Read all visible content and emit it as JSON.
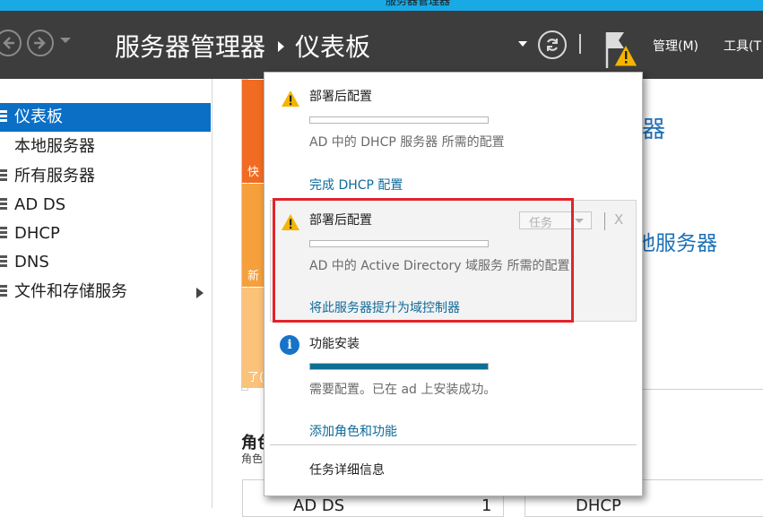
{
  "window_title_fragment": "服务器管理器",
  "header": {
    "breadcrumb_root": "服务器管理器",
    "breadcrumb_current": "仪表板",
    "manage_label": "管理(M)",
    "tools_label": "工具(T"
  },
  "sidebar": {
    "items": [
      {
        "label": "仪表板",
        "active": true
      },
      {
        "label": "本地服务器"
      },
      {
        "label": "所有服务器"
      },
      {
        "label": "AD DS"
      },
      {
        "label": "DHCP"
      },
      {
        "label": "DNS"
      },
      {
        "label": "文件和存储服务"
      }
    ]
  },
  "background": {
    "tile1_text": "快",
    "tile2_text": "新",
    "tile3_text": "了(",
    "right_text1": "器",
    "right_text2": "地服务器",
    "roles_title": "角色",
    "roles_sub": "角色",
    "role_card1": "AD DS",
    "role_card1_count": "1",
    "role_card2": "DHCP"
  },
  "notifications": [
    {
      "icon": "warning-icon",
      "title": "部署后配置",
      "progress": 0,
      "description": "AD 中的 DHCP 服务器 所需的配置",
      "link": "完成 DHCP 配置"
    },
    {
      "icon": "warning-icon",
      "title": "部署后配置",
      "progress": 0,
      "description": "AD 中的 Active Directory 域服务 所需的配置",
      "link": "将此服务器提升为域控制器",
      "task_dropdown": "任务",
      "close_label": "X"
    },
    {
      "icon": "info-icon",
      "title": "功能安装",
      "progress": 1,
      "description": "需要配置。已在 ad 上安装成功。",
      "link": "添加角色和功能"
    }
  ],
  "footer_link": "任务详细信息",
  "colors": {
    "header_bg": "#3d3d3d",
    "accent_blue": "#0b6fc6",
    "link_blue": "#0e6a9a",
    "progress_fill": "#0e6f93",
    "warning_yellow": "#f4b400",
    "annotation_red": "#e3232a",
    "tile_orange": "#f26b22"
  }
}
